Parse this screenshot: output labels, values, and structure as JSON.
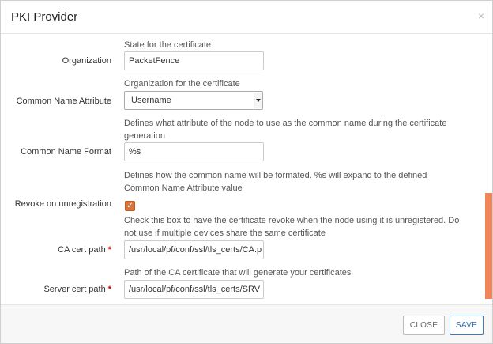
{
  "modal": {
    "title": "PKI Provider",
    "close_glyph": "×"
  },
  "form": {
    "organization": {
      "help_above": "State for the certificate",
      "label": "Organization",
      "value": "PacketFence"
    },
    "common_name_attribute": {
      "help_above": "Organization for the certificate",
      "label": "Common Name Attribute",
      "value": "Username"
    },
    "common_name_format": {
      "help_above": "Defines what attribute of the node to use as the common name during the certificate generation",
      "label": "Common Name Format",
      "value": "%s"
    },
    "revoke_on_unregistration": {
      "help_above": "Defines how the common name will be formated. %s will expand to the defined Common Name Attribute value",
      "label": "Revoke on unregistration",
      "checked": true,
      "check_glyph": "✓"
    },
    "ca_cert_path": {
      "help_above": "Check this box to have the certificate revoke when the node using it is unregistered. Do not use if multiple devices share the same certificate",
      "label": "CA cert path",
      "required_mark": "*",
      "value": "/usr/local/pf/conf/ssl/tls_certs/CA.p"
    },
    "server_cert_path": {
      "help_above": "Path of the CA certificate that will generate your certificates",
      "label": "Server cert path",
      "required_mark": "*",
      "value": "/usr/local/pf/conf/ssl/tls_certs/SRV"
    }
  },
  "footer": {
    "close_label": "CLOSE",
    "save_label": "SAVE"
  },
  "colors": {
    "accent": "#d7773d",
    "scrollbar": "#f0855a",
    "primary_button": "#3c7bb5"
  }
}
